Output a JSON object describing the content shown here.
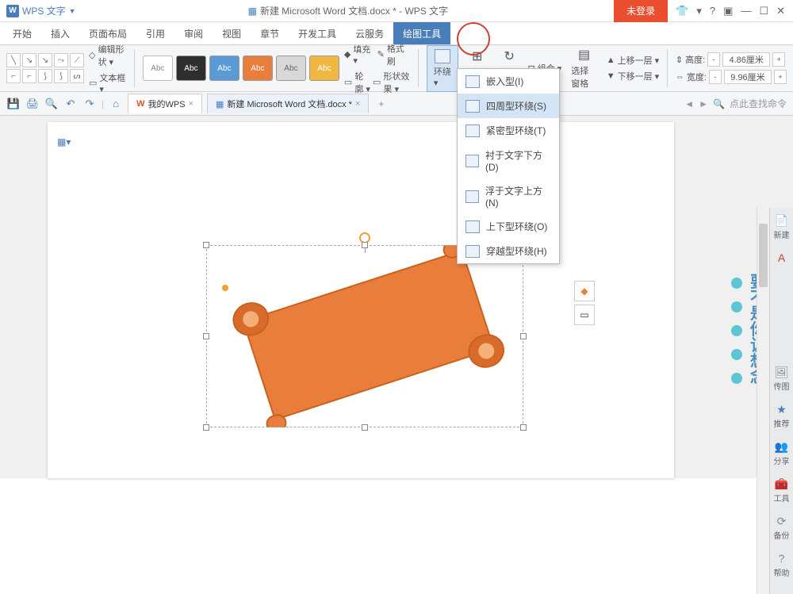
{
  "app": {
    "name": "WPS 文字",
    "title": "新建 Microsoft Word 文档.docx * - WPS 文字"
  },
  "login_label": "未登录",
  "menu": {
    "items": [
      "开始",
      "插入",
      "页面布局",
      "引用",
      "审阅",
      "视图",
      "章节",
      "开发工具",
      "云服务",
      "绘图工具"
    ],
    "active_index": 9
  },
  "ribbon": {
    "edit_shape": "编辑形状 ▾",
    "textbox": "文本框 ▾",
    "styles": [
      {
        "bg": "#ffffff",
        "fg": "#888",
        "label": "Abc"
      },
      {
        "bg": "#2e2e2e",
        "fg": "#fff",
        "label": "Abc"
      },
      {
        "bg": "#5a9bd5",
        "fg": "#fff",
        "label": "Abc"
      },
      {
        "bg": "#e97d3c",
        "fg": "#fff",
        "label": "Abc"
      },
      {
        "bg": "#d8d8d8",
        "fg": "#666",
        "label": "Abc"
      },
      {
        "bg": "#f0b840",
        "fg": "#fff",
        "label": "Abc"
      }
    ],
    "fill": "填充 ▾",
    "outline": "轮廓 ▾",
    "effect": "形状效果 ▾",
    "format_painter": "格式刷",
    "wrap": "环绕 ▾",
    "align": "对齐 ▾",
    "rotate": "旋转 ▾",
    "group": "组合 ▾",
    "pane": "选择窗格",
    "up": "上移一层 ▾",
    "down": "下移一层 ▾",
    "height_lbl": "高度:",
    "height_val": "4.86厘米",
    "width_lbl": "宽度:",
    "width_val": "9.96厘米"
  },
  "tabs": {
    "my": "我的WPS",
    "doc": "新建 Microsoft Word 文档.docx *"
  },
  "search_placeholder": "点此查找命令",
  "wrap_menu": [
    "嵌入型(I)",
    "四周型环绕(S)",
    "紧密型环绕(T)",
    "衬于文字下方(D)",
    "浮于文字上方(N)",
    "上下型环绕(O)",
    "穿越型环绕(H)"
  ],
  "side": {
    "new": "新建",
    "tpl": "传图",
    "rec": "推荐",
    "share": "分享",
    "tools": "工具",
    "backup": "备份",
    "help": "帮助"
  },
  "vtext_chars": [
    "要",
    "不",
    "是",
    "你",
    "让",
    "想",
    "念"
  ]
}
